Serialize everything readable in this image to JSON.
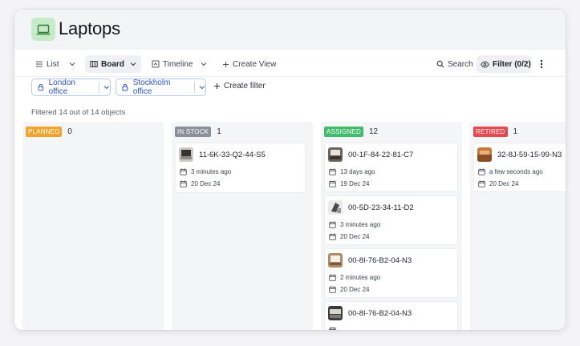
{
  "header": {
    "title": "Laptops",
    "icon": "laptop-icon"
  },
  "toolbar": {
    "list_label": "List",
    "board_label": "Board",
    "timeline_label": "Timeline",
    "create_view_label": "Create View",
    "search_label": "Search",
    "filter_label": "Filter (0/2)"
  },
  "filters": {
    "chips": [
      {
        "label": "London office"
      },
      {
        "label": "Stockholm office"
      }
    ],
    "create_filter_label": "Create filter"
  },
  "summary": {
    "filtered_text": "Filtered 14 out of 14 objects"
  },
  "board": {
    "columns": [
      {
        "status": "PLANNED",
        "count": "0",
        "color": "#f2a32b",
        "cards": []
      },
      {
        "status": "IN STOCK",
        "count": "1",
        "color": "#8b8f97",
        "cards": [
          {
            "title": "11-6K-33-Q2-44-S5",
            "updated": "3 minutes ago",
            "date": "20 Dec 24"
          }
        ]
      },
      {
        "status": "ASSIGNED",
        "count": "12",
        "color": "#3fbd6a",
        "cards": [
          {
            "title": "00-1F-84-22-81-C7",
            "updated": "13 days ago",
            "date": "19 Dec 24"
          },
          {
            "title": "00-5D-23-34-11-D2",
            "updated": "3 minutes ago",
            "date": "20 Dec 24"
          },
          {
            "title": "00-8I-76-B2-04-N3",
            "updated": "2 minutes ago",
            "date": "20 Dec 24"
          },
          {
            "title": "00-8I-76-B2-04-N3",
            "updated": "",
            "date": ""
          }
        ]
      },
      {
        "status": "RETIRED",
        "count": "1",
        "color": "#e5484d",
        "cards": [
          {
            "title": "32-8J-59-15-99-N3",
            "updated": "a few seconds ago",
            "date": "20 Dec 24"
          }
        ]
      }
    ]
  },
  "colors": {
    "accent": "#2f53d8",
    "header_bg": "#f3f4f6",
    "icon_bg": "#c7ebc9"
  }
}
